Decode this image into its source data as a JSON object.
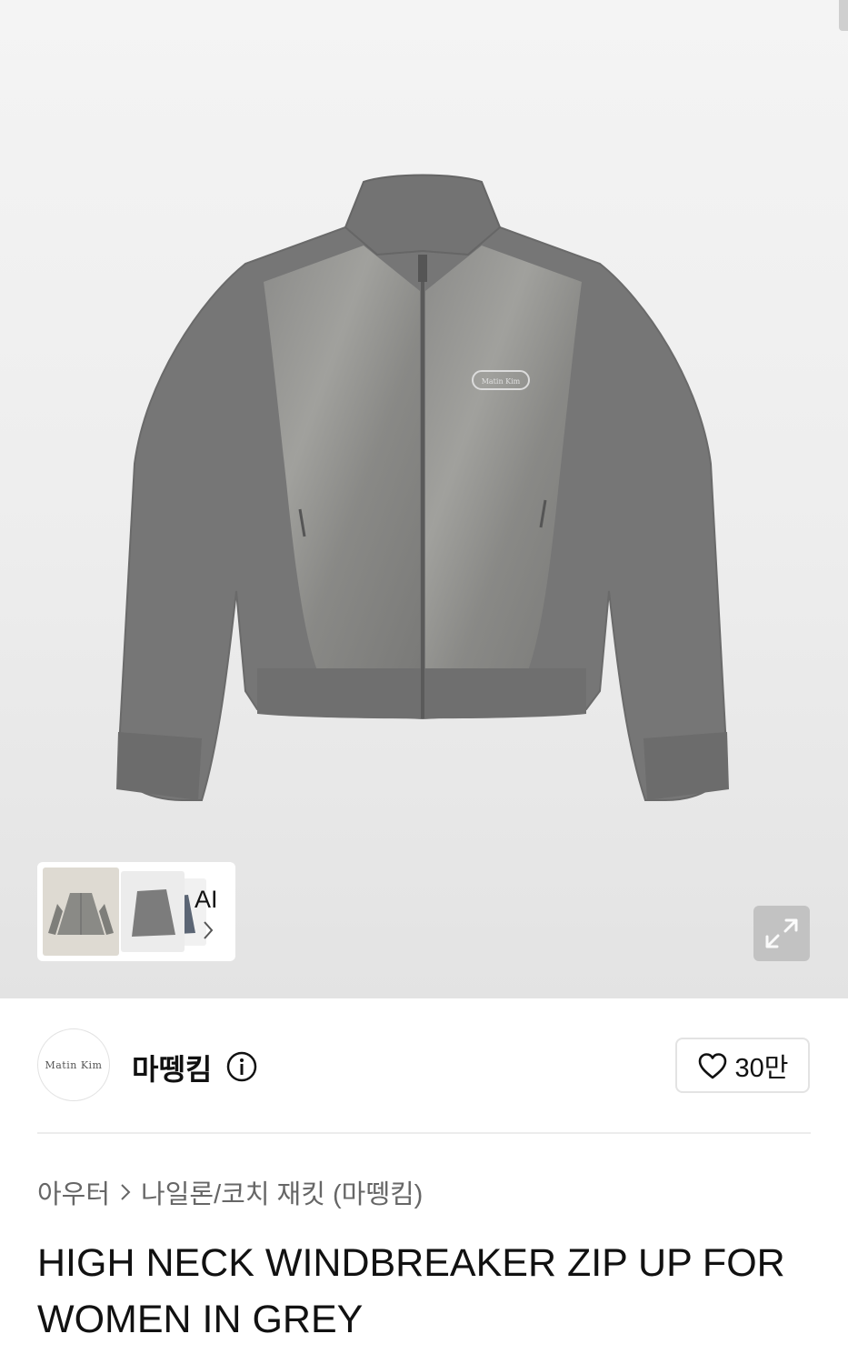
{
  "gallery": {
    "ai_label": "AI",
    "logo_text": "Matin Kim",
    "expand_icon": "expand-icon",
    "chevron_icon": "chevron-right-icon"
  },
  "brand": {
    "logo_text": "Matin Kim",
    "name": "마뗑킴",
    "info_icon": "info-icon"
  },
  "like": {
    "icon": "heart-icon",
    "count": "30만"
  },
  "breadcrumb": {
    "category": "아우터",
    "subcategory": "나일론/코치 재킷 (마뗑킴)"
  },
  "product": {
    "title": "HIGH NECK WINDBREAKER ZIP UP FOR WOMEN IN GREY",
    "color": "#7b7b7b"
  }
}
